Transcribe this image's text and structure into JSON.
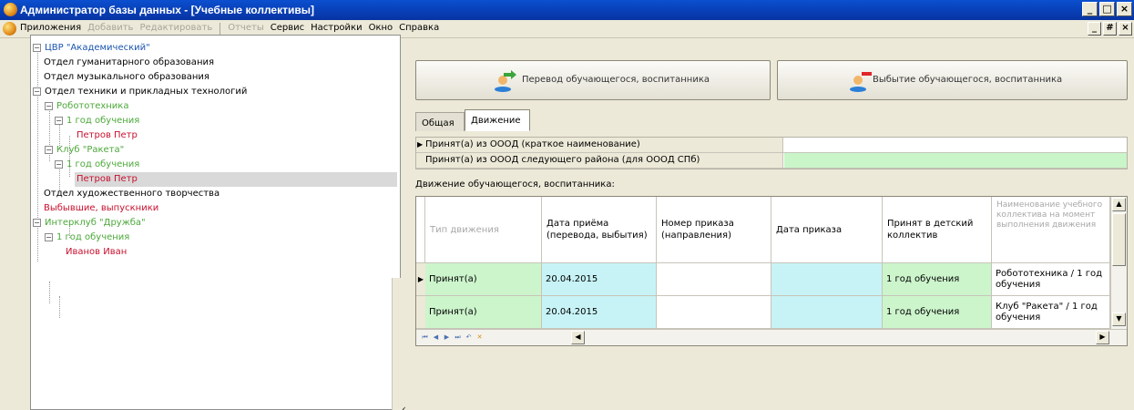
{
  "window": {
    "title": "Администратор базы данных - [Учебные коллективы]",
    "buttons": [
      "_",
      "□",
      "×"
    ],
    "mdi_buttons": [
      "_",
      "#",
      "×"
    ]
  },
  "menu": {
    "items": [
      {
        "label": "Приложения",
        "enabled": true
      },
      {
        "label": "Добавить",
        "enabled": false
      },
      {
        "label": "Редактировать",
        "enabled": false
      },
      {
        "label": "Отчеты",
        "enabled": false
      },
      {
        "label": "Сервис",
        "enabled": true
      },
      {
        "label": "Настройки",
        "enabled": true
      },
      {
        "label": "Окно",
        "enabled": true
      },
      {
        "label": "Справка",
        "enabled": true
      }
    ]
  },
  "tree": {
    "nodes": [
      {
        "label": "ЦВР \"Академический\"",
        "color": "#1a55b0",
        "expander": "−"
      },
      {
        "label": "Отдел гуманитарного образования",
        "color": "#000000"
      },
      {
        "label": "Отдел музыкального образования",
        "color": "#000000"
      },
      {
        "label": "Отдел техники и прикладных технологий",
        "color": "#000000",
        "expander": "−"
      },
      {
        "label": "Робототехника",
        "color": "#4ca83a",
        "expander": "−"
      },
      {
        "label": "1 год обучения",
        "color": "#4ca83a",
        "expander": "−"
      },
      {
        "label": "Петров Петр",
        "color": "#c8102e"
      },
      {
        "label": "Клуб \"Ракета\"",
        "color": "#4ca83a",
        "expander": "−"
      },
      {
        "label": "1 год обучения",
        "color": "#4ca83a",
        "expander": "−"
      },
      {
        "label": "Петров Петр",
        "color": "#c8102e",
        "selected": true
      },
      {
        "label": "Отдел художественного творчества",
        "color": "#000000"
      },
      {
        "label": "Выбывшие, выпускники",
        "color": "#c8102e"
      },
      {
        "label": "Интерклуб \"Дружба\"",
        "color": "#4ca83a",
        "expander": "−"
      },
      {
        "label": "1 год обучения",
        "color": "#4ca83a",
        "expander": "−"
      },
      {
        "label": "Иванов Иван",
        "color": "#c8102e"
      }
    ]
  },
  "actions": {
    "transfer_label": "Перевод обучающегося, воспитанника",
    "dropout_label": "Выбытие обучающегося, воспитанника"
  },
  "tabs": [
    {
      "label": "Общая",
      "active": false
    },
    {
      "label": "Движение",
      "active": true
    }
  ],
  "info": {
    "row1_label": "Принят(а) из ОООД (краткое наименование)",
    "row2_label": "Принят(а) из ОООД следующего района (для ОООД СПб)",
    "row_indicator": "▶"
  },
  "movement": {
    "caption": "Движение обучающегося, воспитанника:",
    "columns": [
      "Тип движения",
      "Дата приёма (перевода, выбытия)",
      "Номер приказа (направления)",
      "Дата приказа",
      "Принят в детский коллектив",
      "Наименование учебного коллектива на момент выполнения движения"
    ],
    "rows": [
      {
        "type": "Принят(а)",
        "date": "20.04.2015",
        "order_no": "",
        "order_date": "",
        "collective": "1 год обучения",
        "name": "Робототехника / 1 год обучения"
      },
      {
        "type": "Принят(а)",
        "date": "20.04.2015",
        "order_no": "",
        "order_date": "",
        "collective": "1 год обучения",
        "name": "Клуб \"Ракета\" / 1 год обучения"
      }
    ],
    "navigator": [
      "⏮",
      "◀",
      "▶",
      "⏭",
      "↶",
      "✕"
    ]
  },
  "colors": {
    "title_bar": "#0b4fcf",
    "chrome": "#ece9d8",
    "row_green": "#ccf5cc",
    "row_cyan": "#c7f3f6",
    "info_green": "#c9f5c9"
  }
}
